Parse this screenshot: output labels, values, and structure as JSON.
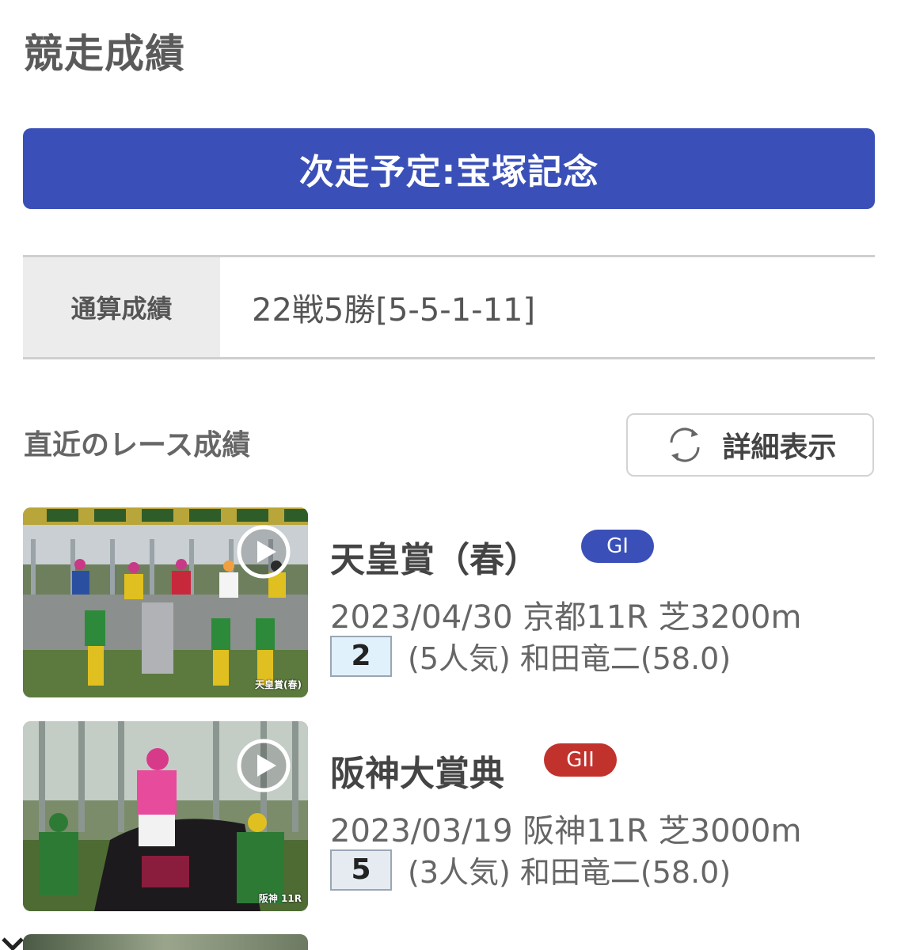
{
  "page": {
    "title": "競走成績",
    "next_race": "次走予定:宝塚記念"
  },
  "record": {
    "label": "通算成績",
    "value": "22戦5勝[5-5-1-11]"
  },
  "recent": {
    "title": "直近のレース成績",
    "detail_button": "詳細表示"
  },
  "races": [
    {
      "name": "天皇賞（春）",
      "grade": "GI",
      "grade_color": "#3a50b8",
      "info": "2023/04/30 京都11R 芝3200m",
      "place": "2",
      "place_bg": "#e1f1fb",
      "result": "(5人気) 和田竜二(58.0)",
      "caption": "天皇賞(春)"
    },
    {
      "name": "阪神大賞典",
      "grade": "GII",
      "grade_color": "#c2322d",
      "info": "2023/03/19 阪神11R 芝3000m",
      "place": "5",
      "place_bg": "#e6ebf2",
      "result": "(3人気) 和田竜二(58.0)",
      "caption": "阪神 11R"
    }
  ]
}
